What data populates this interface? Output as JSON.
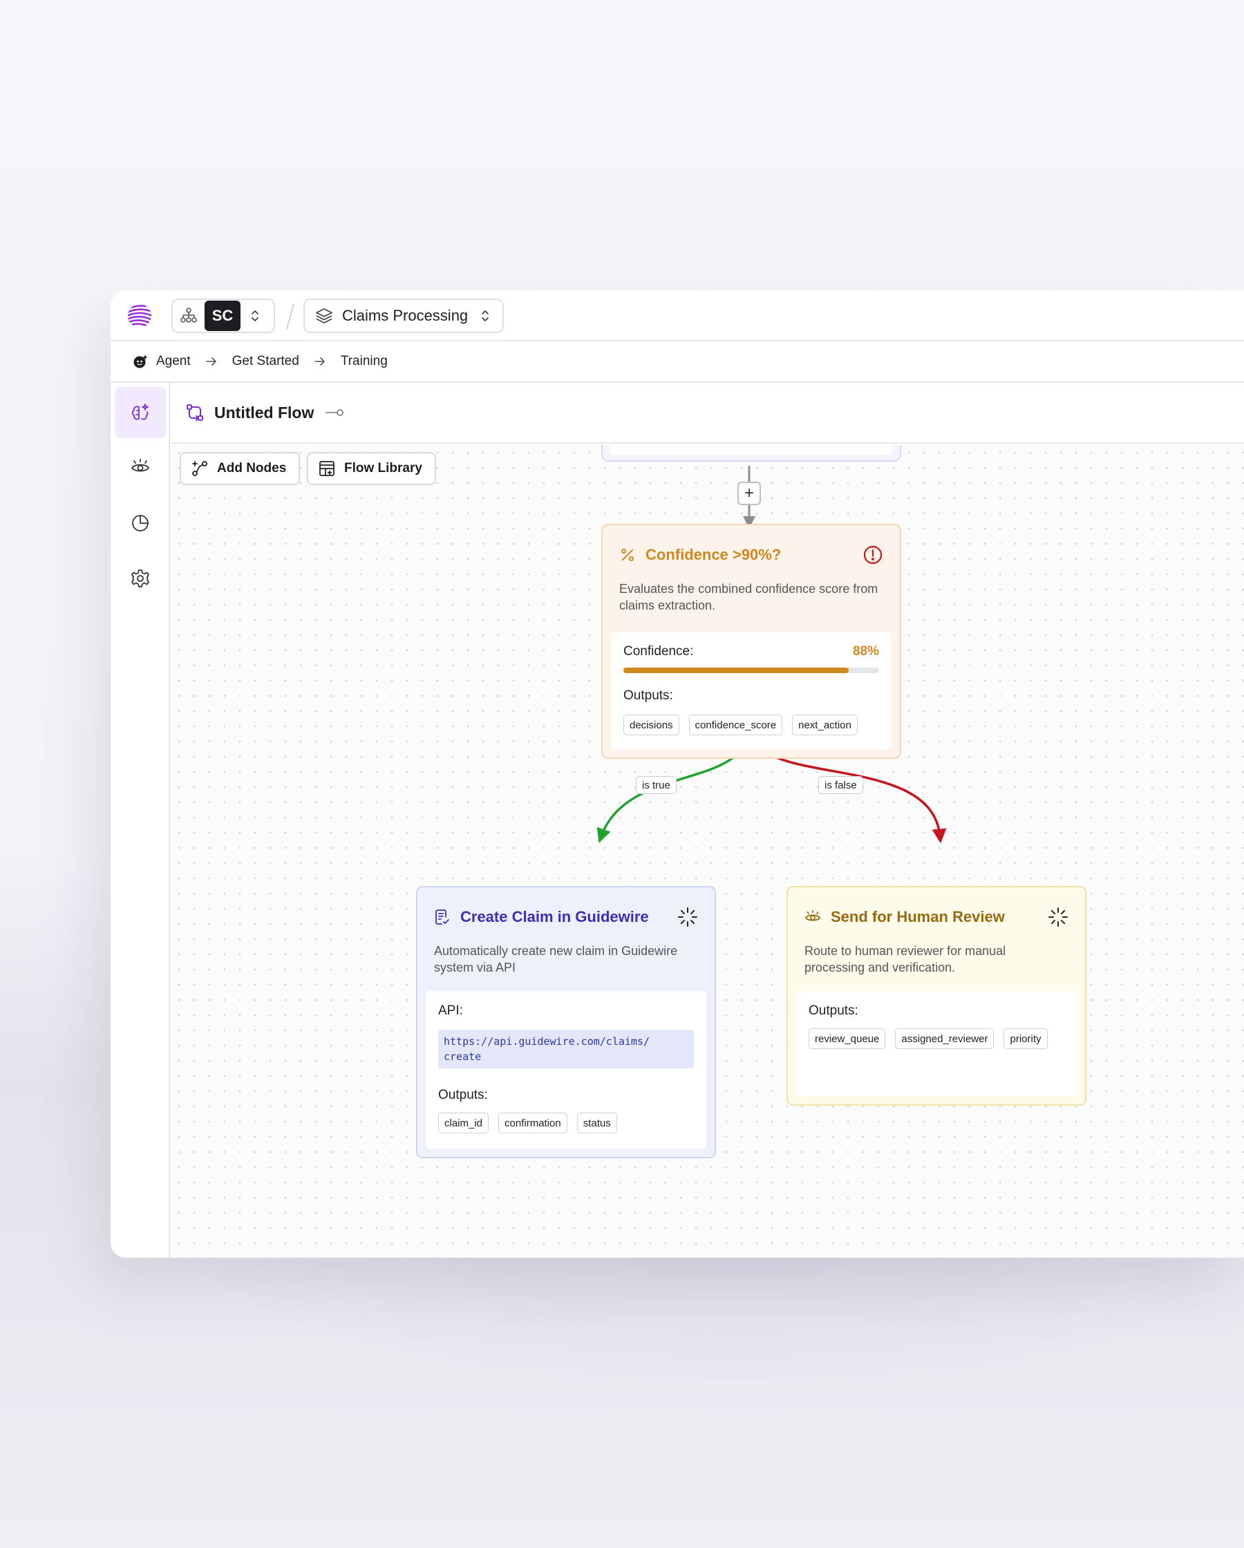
{
  "topbar": {
    "org_badge": "SC",
    "project_name": "Claims Processing"
  },
  "breadcrumb": {
    "items": [
      "Agent",
      "Get Started",
      "Training"
    ]
  },
  "sidebar": {
    "items": [
      {
        "icon": "brain-sparkle-icon",
        "active": true
      },
      {
        "icon": "eye-icon",
        "active": false
      },
      {
        "icon": "pie-chart-icon",
        "active": false
      },
      {
        "icon": "gear-icon",
        "active": false
      }
    ]
  },
  "flow": {
    "title": "Untitled Flow"
  },
  "toolbar": {
    "add_nodes_label": "Add Nodes",
    "flow_library_label": "Flow Library"
  },
  "edges": {
    "true_label": "is true",
    "false_label": "is false"
  },
  "nodes": {
    "confidence": {
      "title": "Confidence >90%?",
      "description": "Evaluates the combined confidence score from claims extraction.",
      "confidence_label": "Confidence:",
      "confidence_value": "88%",
      "confidence_fraction": 0.88,
      "outputs_label": "Outputs:",
      "outputs": [
        "decisions",
        "confidence_score",
        "next_action"
      ],
      "status_icon": "alert-circle-icon",
      "accent": "#d0881b"
    },
    "create_claim": {
      "title": "Create Claim in Guidewire",
      "description": "Automatically create new claim in Guidewire system via API",
      "api_label": "API:",
      "api_url_line1": "https://api.guidewire.com/claims/",
      "api_url_line2": "create",
      "outputs_label": "Outputs:",
      "outputs": [
        "claim_id",
        "confirmation",
        "status"
      ],
      "status_icon": "loading-spinner-icon",
      "accent": "#3b2fb5"
    },
    "human_review": {
      "title": "Send for Human Review",
      "description": "Route to human reviewer for manual processing and verification.",
      "outputs_label": "Outputs:",
      "outputs": [
        "review_queue",
        "assigned_reviewer",
        "priority"
      ],
      "status_icon": "loading-spinner-icon",
      "accent": "#9a6a12"
    }
  },
  "colors": {
    "brand": "#8a2be2",
    "true_edge": "#22a231",
    "false_edge": "#c4161c"
  }
}
